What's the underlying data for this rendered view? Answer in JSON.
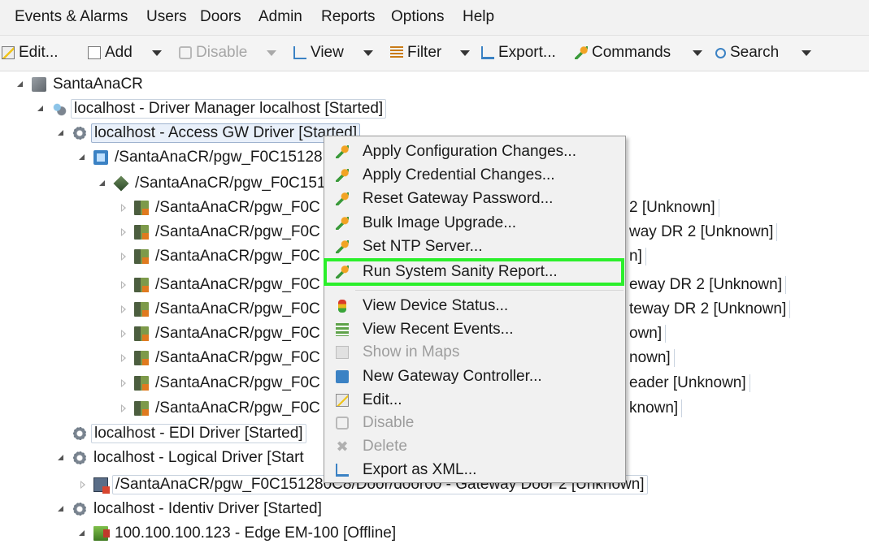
{
  "menu": [
    "Events & Alarms",
    "Users",
    "Doors",
    "Admin",
    "Reports",
    "Options",
    "Help"
  ],
  "toolbar": {
    "edit": "Edit...",
    "add": "Add",
    "disable": "Disable",
    "view": "View",
    "filter": "Filter",
    "export": "Export...",
    "commands": "Commands",
    "search": "Search"
  },
  "tree": [
    {
      "label": "SantaAnaCR",
      "icon": "server-icon"
    },
    {
      "label": "localhost - Driver Manager localhost [Started]",
      "icon": "driver-manager-icon"
    },
    {
      "label": "localhost - Access GW Driver [Started]",
      "icon": "driver-gear-icon"
    },
    {
      "label": "/SantaAnaCR/pgw_F0C15128",
      "icon": "gateway-controller-icon"
    },
    {
      "label": "/SantaAnaCR/pgw_F0C151",
      "icon": "gateway-device-icon"
    },
    {
      "label": "/SantaAnaCR/pgw_F0C",
      "tail": "2 [Unknown]",
      "icon": "reader-icon"
    },
    {
      "label": "/SantaAnaCR/pgw_F0C",
      "tail": "way DR 2 [Unknown]",
      "icon": "reader-icon"
    },
    {
      "label": "/SantaAnaCR/pgw_F0C",
      "tail": "n]",
      "icon": "reader-icon"
    },
    {
      "label": "/SantaAnaCR/pgw_F0C",
      "tail": "eway DR 2 [Unknown]",
      "icon": "reader-icon"
    },
    {
      "label": "/SantaAnaCR/pgw_F0C",
      "tail": "teway DR 2 [Unknown]",
      "icon": "reader-icon"
    },
    {
      "label": "/SantaAnaCR/pgw_F0C",
      "tail": "own]",
      "icon": "reader-icon"
    },
    {
      "label": "/SantaAnaCR/pgw_F0C",
      "tail": "nown]",
      "icon": "reader-icon"
    },
    {
      "label": "/SantaAnaCR/pgw_F0C",
      "tail": "eader [Unknown]",
      "icon": "reader-icon"
    },
    {
      "label": "/SantaAnaCR/pgw_F0C",
      "tail": "known]",
      "icon": "reader-icon"
    },
    {
      "label": "localhost - EDI Driver [Started]",
      "icon": "driver-gear-icon"
    },
    {
      "label": "localhost - Logical Driver [Start",
      "icon": "driver-gear-icon"
    },
    {
      "label": "/SantaAnaCR/pgw_F0C151280C8/Door/door00 - Gateway Door 2 [Unknown]",
      "icon": "door-icon"
    },
    {
      "label": "localhost - Identiv Driver [Started]",
      "icon": "driver-gear-icon"
    },
    {
      "label": "100.100.100.123 - Edge EM-100 [Offline]",
      "icon": "edge-device-icon"
    }
  ],
  "context_menu": [
    {
      "label": "Apply Configuration Changes...",
      "icon": "command-icon"
    },
    {
      "label": "Apply Credential Changes...",
      "icon": "command-icon"
    },
    {
      "label": "Reset Gateway Password...",
      "icon": "command-icon"
    },
    {
      "label": "Bulk Image Upgrade...",
      "icon": "command-icon"
    },
    {
      "label": "Set NTP Server...",
      "icon": "command-icon"
    },
    {
      "label": "Run System Sanity Report...",
      "icon": "command-icon",
      "highlighted": true
    },
    {
      "label": "View Device Status...",
      "icon": "traffic-light-icon"
    },
    {
      "label": "View Recent Events...",
      "icon": "event-list-icon"
    },
    {
      "label": "Show in Maps",
      "icon": "map-icon",
      "disabled": true
    },
    {
      "label": "New Gateway Controller...",
      "icon": "gateway-controller-icon"
    },
    {
      "label": "Edit...",
      "icon": "edit-icon"
    },
    {
      "label": "Disable",
      "icon": "disable-icon",
      "disabled": true
    },
    {
      "label": "Delete",
      "icon": "delete-icon",
      "disabled": true
    },
    {
      "label": "Export as XML...",
      "icon": "export-icon"
    }
  ],
  "highlight_color": "#2bef2b"
}
